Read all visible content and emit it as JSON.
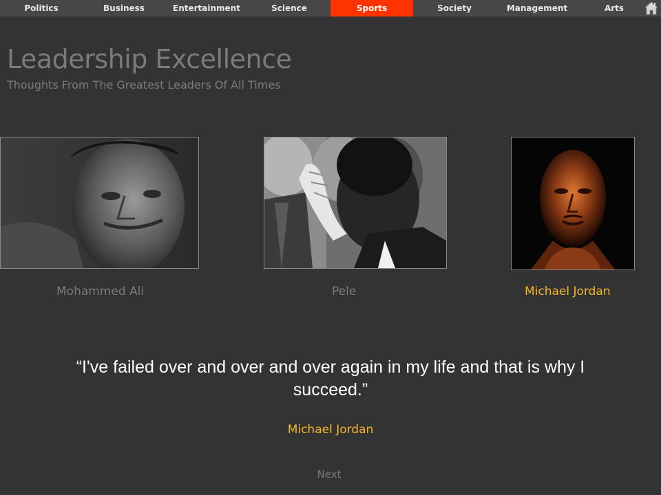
{
  "nav": {
    "items": [
      {
        "label": "Politics"
      },
      {
        "label": "Business"
      },
      {
        "label": "Entertainment"
      },
      {
        "label": "Science"
      },
      {
        "label": "Sports",
        "active": true
      },
      {
        "label": "Society"
      },
      {
        "label": "Management"
      },
      {
        "label": "Arts"
      }
    ],
    "home_icon": "home-icon",
    "active_color": "#ff3300"
  },
  "header": {
    "title": "Leadership Excellence",
    "subtitle": "Thoughts From The Greatest Leaders Of All Times"
  },
  "leaders": [
    {
      "name": "Mohammed Ali",
      "selected": false
    },
    {
      "name": "Pele",
      "selected": false
    },
    {
      "name": "Michael Jordan",
      "selected": true
    }
  ],
  "quote": {
    "text": "“I've failed over and over and over again in my life and that is why I succeed.”",
    "author": "Michael Jordan"
  },
  "footer": {
    "next_label": "Next"
  },
  "colors": {
    "background": "#333333",
    "accent": "#f7b52c",
    "muted_text": "#7b7b7b"
  }
}
